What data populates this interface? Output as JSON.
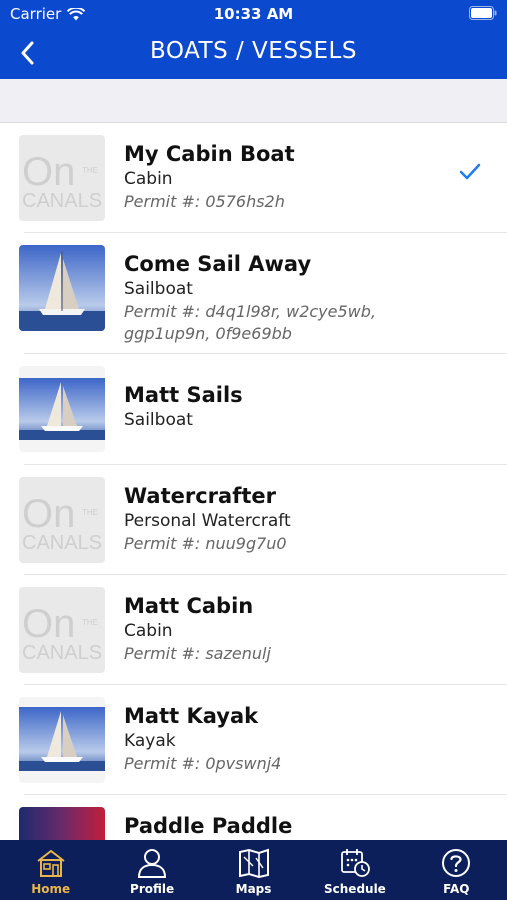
{
  "status_bar": {
    "carrier": "Carrier",
    "time": "10:33 AM"
  },
  "nav": {
    "title": "BOATS / VESSELS"
  },
  "logo_text": {
    "on": "On",
    "the": "THE",
    "canals": "CANALS"
  },
  "vessels": [
    {
      "name": "My Cabin Boat",
      "type": "Cabin",
      "permit_line1": "Permit #: 0576hs2h",
      "permit_line2": "",
      "thumbnail": "on-the-canals-logo",
      "selected": true
    },
    {
      "name": "Come Sail Away",
      "type": "Sailboat",
      "permit_line1": "Permit #: d4q1l98r, w2cye5wb,",
      "permit_line2": "ggp1up9n, 0f9e69bb",
      "thumbnail": "sailboat-photo",
      "selected": false
    },
    {
      "name": "Matt Sails",
      "type": "Sailboat",
      "permit_line1": "",
      "permit_line2": "",
      "thumbnail": "sailboat-photo",
      "selected": false
    },
    {
      "name": "Watercrafter",
      "type": "Personal Watercraft",
      "permit_line1": "Permit #: nuu9g7u0",
      "permit_line2": "",
      "thumbnail": "on-the-canals-logo",
      "selected": false
    },
    {
      "name": "Matt Cabin",
      "type": "Cabin",
      "permit_line1": "Permit #: sazenulj",
      "permit_line2": "",
      "thumbnail": "on-the-canals-logo",
      "selected": false
    },
    {
      "name": "Matt Kayak",
      "type": "Kayak",
      "permit_line1": "Permit #: 0pvswnj4",
      "permit_line2": "",
      "thumbnail": "sailboat-photo",
      "selected": false
    },
    {
      "name": "Paddle Paddle",
      "type": "",
      "permit_line1": "",
      "permit_line2": "",
      "thumbnail": "paddle-photo",
      "selected": false
    }
  ],
  "tabs": [
    {
      "label": "Home",
      "icon": "home-icon",
      "active": true
    },
    {
      "label": "Profile",
      "icon": "profile-icon",
      "active": false
    },
    {
      "label": "Maps",
      "icon": "map-icon",
      "active": false
    },
    {
      "label": "Schedule",
      "icon": "schedule-icon",
      "active": false
    },
    {
      "label": "FAQ",
      "icon": "faq-icon",
      "active": false
    }
  ],
  "colors": {
    "nav_blue": "#0b49cf",
    "tab_bar": "#0c1f5a",
    "active_tab": "#e8b64c",
    "check_blue": "#1e7cf0"
  }
}
